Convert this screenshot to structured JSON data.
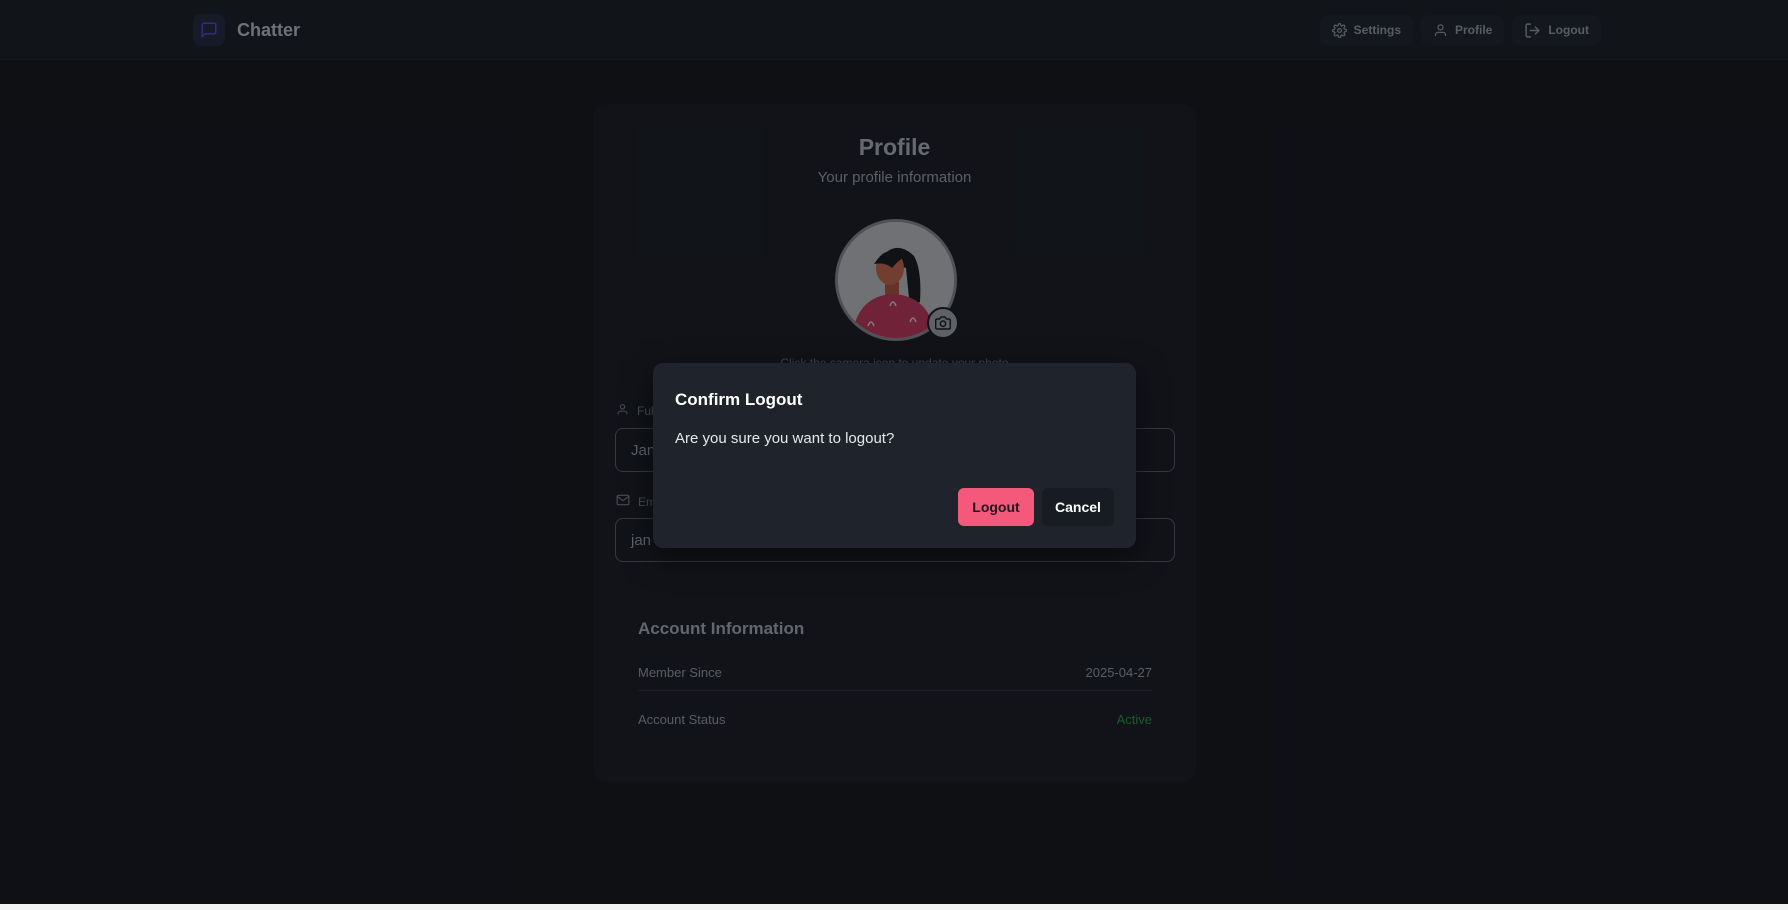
{
  "header": {
    "brand_name": "Chatter",
    "nav": {
      "settings": "Settings",
      "profile": "Profile",
      "logout": "Logout"
    }
  },
  "profile": {
    "title": "Profile",
    "subtitle": "Your profile information",
    "photo_hint": "Click the camera icon to update your photo",
    "full_name_label": "Full Name",
    "full_name_value": "Jan",
    "email_label": "Email Address",
    "email_value": "jan"
  },
  "account": {
    "title": "Account Information",
    "member_since_label": "Member Since",
    "member_since_value": "2025-04-27",
    "status_label": "Account Status",
    "status_value": "Active"
  },
  "modal": {
    "title": "Confirm Logout",
    "message": "Are you sure you want to logout?",
    "confirm_label": "Logout",
    "cancel_label": "Cancel"
  },
  "colors": {
    "accent": "#f4587a",
    "brand_icon": "#5b4ad1",
    "active_status": "#2f9e44"
  }
}
